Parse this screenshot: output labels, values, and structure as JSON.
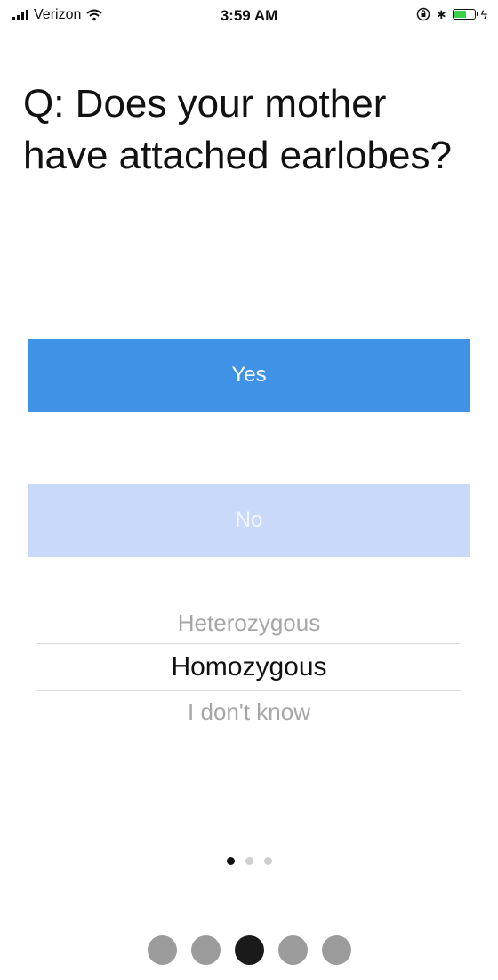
{
  "status_bar": {
    "carrier": "Verizon",
    "time": "3:59 AM",
    "bluetooth_glyph": "∗",
    "charge_glyph": "ϟ",
    "battery_color": "#3bd14a",
    "icons": [
      "signal-bars-icon",
      "wifi-icon",
      "rotation-lock-icon",
      "bluetooth-icon",
      "battery-icon",
      "charging-icon"
    ]
  },
  "question": {
    "text": "Q: Does your mother have attached earlobes?"
  },
  "answers": {
    "yes_label": "Yes",
    "no_label": "No",
    "yes_color": "#3f92e6",
    "no_color": "#c9d9fa"
  },
  "picker": {
    "options": [
      "Heterozygous",
      "Homozygous",
      "I don't know"
    ],
    "selected": "Homozygous"
  },
  "page_indicator": {
    "total": 3,
    "current": 1
  },
  "progress_indicator": {
    "total": 5,
    "current": 3,
    "active_color": "#1a1a1a",
    "inactive_color": "#9b9b9b"
  }
}
